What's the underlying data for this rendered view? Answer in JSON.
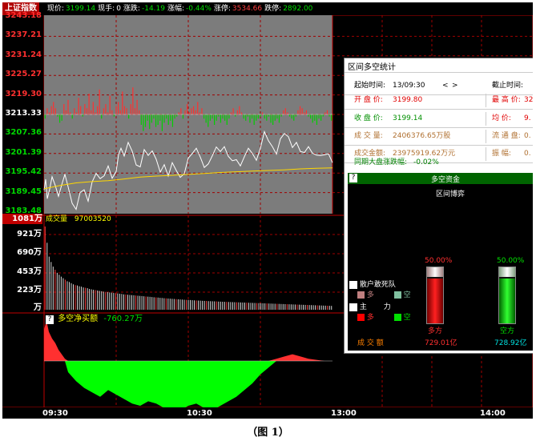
{
  "header": {
    "title": "上证指数",
    "items": [
      {
        "label": "现价:",
        "value": "3199.14",
        "color": "#00e000"
      },
      {
        "label": "现手:",
        "value": "0",
        "color": "#ffffff"
      },
      {
        "label": "涨跌:",
        "value": "-14.19",
        "color": "#00e000"
      },
      {
        "label": "涨幅:",
        "value": "-0.44%",
        "color": "#00e000"
      },
      {
        "label": "涨停:",
        "value": "3534.66",
        "color": "#ff4040"
      },
      {
        "label": "跌停:",
        "value": "2892.00",
        "color": "#00e000"
      }
    ]
  },
  "price_axis": {
    "labels": [
      "3243.18",
      "3237.21",
      "3231.24",
      "3225.27",
      "3219.30",
      "3213.33",
      "3207.36",
      "3201.39",
      "3195.42",
      "3189.45",
      "3183.48"
    ],
    "ref_index": 5,
    "up_color": "#ff3030",
    "down_color": "#00d800",
    "ref_color": "#ffffff"
  },
  "volume": {
    "title_label": "成交量",
    "title_value": "97003520",
    "highlight_label": "1081万",
    "labels": [
      "921万",
      "690万",
      "453万",
      "223万",
      "万"
    ]
  },
  "net_buy": {
    "help_mark": "?",
    "title": "多空净买额",
    "value": "-760.27万"
  },
  "time_axis": [
    "09:30",
    "10:30",
    "13:00",
    "14:00"
  ],
  "caption": "（图 1）",
  "panel": {
    "title": "区间多空统计",
    "start_label": "起始时间:",
    "start_value": "13/09:30",
    "nav_prev": "<",
    "nav_next": ">",
    "end_label": "截止时间:",
    "rows_left": [
      {
        "label": "开 盘 价:",
        "value": "3199.80",
        "color": "#e00000"
      },
      {
        "label": "收 盘 价:",
        "value": "3199.14",
        "color": "#009000"
      },
      {
        "label": "成 交 量:",
        "value": "2406376.65万股",
        "color": "#b07030"
      },
      {
        "label": "成交金额:",
        "value": "23975919.62万元",
        "color": "#b07030"
      }
    ],
    "rows_right": [
      {
        "label": "最 高 价:",
        "value": "32",
        "color": "#e00000"
      },
      {
        "label": "均    价:",
        "value": "9.",
        "color": "#e00000"
      },
      {
        "label": "流 通 盘:",
        "value": "0.",
        "color": "#b07030"
      },
      {
        "label": "振    幅:",
        "value": "0.",
        "color": "#b07030"
      }
    ],
    "market_label": "同期大盘涨跌幅:",
    "market_value": "-0.02%",
    "sub_help": "?",
    "sub_title": "多空资金",
    "game_title": "区间博弈",
    "long_pct": 50.0,
    "short_pct": 50.0,
    "long_pct_text": "50.00%",
    "short_pct_text": "50.00%",
    "long_label": "多方",
    "short_label": "空方",
    "long_value": "729.01亿",
    "short_value": "728.92亿",
    "retail_label": "散户敢死队",
    "retail_long": "多",
    "retail_short": "空",
    "main_label": "主",
    "main_force": "力",
    "main_long": "多",
    "main_short": "空",
    "turnover_label": "成  交  额"
  },
  "chart_data": {
    "type": "line",
    "ylim": [
      3183.48,
      3243.18
    ],
    "ref_price": 3213.33,
    "price_x": [
      0,
      2,
      4,
      7,
      10,
      14,
      18,
      22,
      26,
      30,
      35,
      40,
      45,
      50,
      55,
      60,
      65,
      70,
      75,
      80,
      85,
      90,
      93,
      96,
      100,
      105,
      110,
      115,
      120,
      125,
      130,
      135,
      140,
      145,
      150,
      155,
      160,
      165,
      170,
      175,
      180,
      185,
      190,
      195,
      200,
      205,
      210,
      215,
      220,
      225,
      230,
      235,
      240,
      245,
      250,
      255,
      260,
      265,
      270,
      275,
      280,
      285,
      290,
      295,
      300,
      305,
      310,
      315,
      320,
      325,
      330,
      335,
      340,
      345,
      350,
      355,
      360
    ],
    "price": [
      3190.2,
      3193.5,
      3187.6,
      3190.5,
      3194.3,
      3191.6,
      3188.3,
      3191.8,
      3195.0,
      3191.2,
      3186.2,
      3184.3,
      3189.5,
      3190.3,
      3186.8,
      3192.7,
      3195.3,
      3193.7,
      3194.6,
      3197.6,
      3193.8,
      3195.9,
      3201.1,
      3203.0,
      3200.6,
      3204.8,
      3202.1,
      3197.9,
      3197.3,
      3202.6,
      3200.8,
      3202.2,
      3199.6,
      3195.7,
      3198.0,
      3194.5,
      3198.6,
      3196.2,
      3194.1,
      3195.2,
      3200.0,
      3201.4,
      3203.0,
      3200.3,
      3197.1,
      3198.2,
      3200.7,
      3203.4,
      3202.0,
      3203.5,
      3200.5,
      3199.2,
      3199.5,
      3197.6,
      3200.4,
      3203.0,
      3201.4,
      3199.3,
      3203.0,
      3208.1,
      3205.3,
      3203.5,
      3201.2,
      3205.9,
      3207.5,
      3206.5,
      3203.2,
      3204.8,
      3202.0,
      3201.7,
      3203.5,
      3201.5,
      3200.9,
      3200.8,
      3201.0,
      3201.3,
      3198.6
    ],
    "avg_x": [
      0,
      20,
      40,
      60,
      80,
      100,
      120,
      140,
      160,
      180,
      200,
      220,
      240,
      260,
      280,
      300,
      320,
      340,
      360
    ],
    "avg": [
      3190.6,
      3191.6,
      3192.4,
      3192.8,
      3193.1,
      3193.6,
      3194.2,
      3194.5,
      3194.7,
      3195.0,
      3195.3,
      3195.6,
      3195.8,
      3196.0,
      3196.2,
      3196.4,
      3196.7,
      3196.9,
      3197.0
    ],
    "x_total": 360,
    "fund_flow": [
      -2,
      3,
      1,
      4,
      6,
      3,
      -1,
      -4,
      -3,
      5,
      2,
      7,
      1,
      -2,
      3,
      1,
      8,
      4,
      -1,
      5,
      3,
      10,
      2,
      6,
      1,
      4,
      12,
      -2,
      3,
      5,
      1,
      9,
      2,
      -1,
      4,
      6,
      2,
      11,
      4,
      3,
      -2,
      5,
      13,
      3,
      7,
      2,
      -5,
      -8,
      -6,
      -3,
      -7,
      -4,
      -2,
      -6,
      -5,
      -3,
      -8,
      -4,
      -2,
      -5,
      -3,
      -6,
      -2,
      -1,
      1,
      3,
      -2,
      2,
      5,
      1,
      3,
      4,
      2,
      6,
      1,
      3,
      -2,
      -4,
      -6,
      -3,
      -2,
      -5,
      -3,
      -1,
      -4,
      -2,
      -3,
      -5,
      -2,
      1,
      3,
      -1,
      2,
      4,
      1,
      -2,
      -3,
      -1,
      -4,
      -2,
      -5,
      -3,
      -2,
      -1,
      1,
      -2,
      -3,
      -1,
      -4,
      -5,
      -3,
      -2,
      -4,
      -1,
      2,
      3,
      1,
      -1,
      -2,
      -3,
      -1,
      2,
      4,
      3,
      1,
      2,
      -1,
      -2,
      -4,
      -3,
      -5,
      -2,
      -3,
      -1,
      1,
      2,
      -1,
      -3
    ],
    "volume_max": 1081,
    "volume": [
      1081,
      870,
      690,
      620,
      560,
      520,
      480,
      455,
      430,
      410,
      390,
      370,
      360,
      345,
      330,
      320,
      315,
      305,
      300,
      290,
      285,
      280,
      270,
      265,
      260,
      255,
      250,
      245,
      240,
      235,
      232,
      228,
      225,
      222,
      218,
      215,
      212,
      208,
      205,
      200,
      198,
      195,
      192,
      190,
      188,
      185,
      182,
      180,
      178,
      175,
      172,
      170,
      168,
      165,
      162,
      160,
      158,
      155,
      153,
      150,
      148,
      146,
      144,
      142,
      140,
      138,
      136,
      134,
      132,
      130,
      128,
      127,
      126,
      124,
      122,
      120,
      119,
      118,
      116,
      115,
      114,
      112,
      111,
      110,
      109,
      108,
      106,
      105,
      104,
      103,
      102,
      101,
      100,
      99,
      98,
      97,
      96,
      95,
      94,
      93,
      92,
      91,
      90,
      89,
      88,
      87,
      86,
      85,
      84,
      83,
      82,
      81,
      80,
      79,
      78,
      77,
      76,
      75,
      74,
      73,
      72,
      71,
      70,
      69,
      68,
      67,
      66,
      65,
      64,
      63,
      62,
      61,
      60,
      59,
      58,
      57,
      56,
      55,
      54,
      53,
      52,
      51,
      50
    ],
    "net_buy_x": [
      0,
      3,
      6,
      10,
      14,
      18,
      22,
      26,
      30,
      40,
      50,
      60,
      70,
      80,
      90,
      100,
      110,
      120,
      130,
      140,
      150,
      160,
      170,
      180,
      190,
      200,
      210,
      220,
      230,
      240,
      250,
      260,
      270,
      280,
      290,
      300,
      310,
      320,
      330,
      340,
      350,
      360
    ],
    "net_buy": [
      1.4,
      1.8,
      1.3,
      1.0,
      0.8,
      0.5,
      0.3,
      0.1,
      -0.5,
      -0.9,
      -1.2,
      -1.4,
      -1.6,
      -1.3,
      -1.5,
      -1.7,
      -1.9,
      -2.0,
      -1.8,
      -1.9,
      -2.1,
      -2.3,
      -2.2,
      -2.0,
      -1.9,
      -2.1,
      -2.2,
      -2.0,
      -1.8,
      -1.6,
      -1.3,
      -1.0,
      -0.6,
      -0.3,
      0.1,
      0.2,
      0.3,
      0.2,
      0.1,
      0.05,
      0.0,
      0.0
    ]
  }
}
